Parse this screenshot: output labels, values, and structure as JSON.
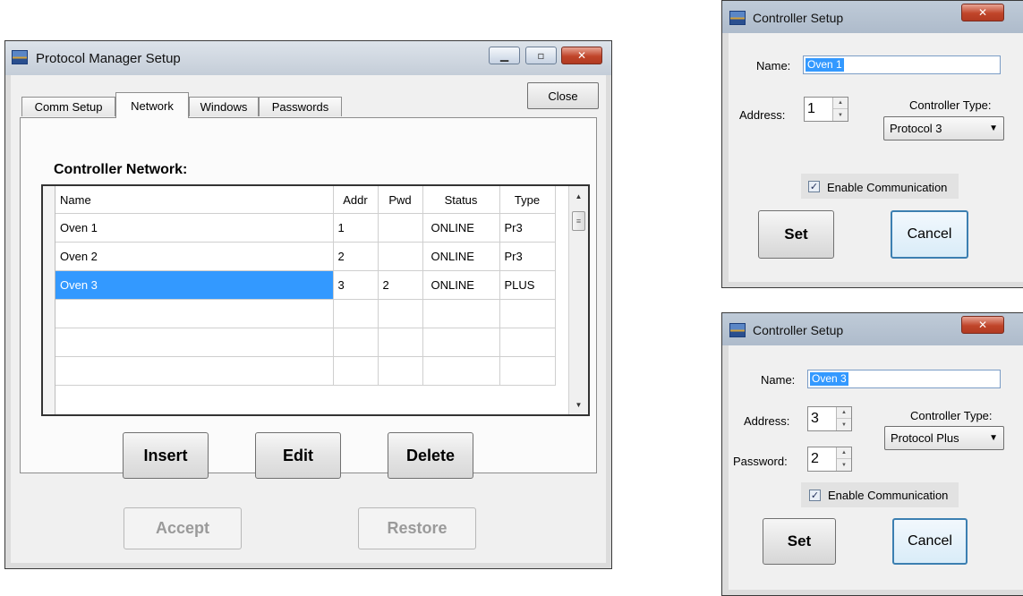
{
  "main_window": {
    "title": "Protocol Manager Setup",
    "close_label": "Close",
    "tabs": [
      {
        "label": "Comm Setup",
        "active": false
      },
      {
        "label": "Network",
        "active": true
      },
      {
        "label": "Windows",
        "active": false
      },
      {
        "label": "Passwords",
        "active": false
      }
    ],
    "section_label": "Controller Network:",
    "table": {
      "headers": [
        "Name",
        "Addr",
        "Pwd",
        "Status",
        "Type"
      ],
      "rows": [
        [
          "Oven 1",
          "1",
          "",
          "ONLINE",
          "Pr3"
        ],
        [
          "Oven 2",
          "2",
          "",
          "ONLINE",
          "Pr3"
        ],
        [
          "Oven 3",
          "3",
          "2",
          "ONLINE",
          "PLUS"
        ],
        [
          "",
          "",
          "",
          "",
          ""
        ],
        [
          "",
          "",
          "",
          "",
          ""
        ],
        [
          "",
          "",
          "",
          "",
          ""
        ]
      ],
      "selected_row": 2
    },
    "buttons": {
      "insert": "Insert",
      "edit": "Edit",
      "delete": "Delete",
      "accept": "Accept",
      "restore": "Restore"
    }
  },
  "dialog1": {
    "title": "Controller Setup",
    "name_label": "Name:",
    "name_value": "Oven 1",
    "address_label": "Address:",
    "address_value": "1",
    "type_label": "Controller Type:",
    "type_value": "Protocol 3",
    "enable_label": "Enable Communication",
    "enable_checked": true,
    "set_label": "Set",
    "cancel_label": "Cancel"
  },
  "dialog2": {
    "title": "Controller Setup",
    "name_label": "Name:",
    "name_value": "Oven 3",
    "address_label": "Address:",
    "address_value": "3",
    "password_label": "Password:",
    "password_value": "2",
    "type_label": "Controller Type:",
    "type_value": "Protocol Plus",
    "enable_label": "Enable Communication",
    "enable_checked": true,
    "set_label": "Set",
    "cancel_label": "Cancel"
  },
  "icons": {
    "app": "app-icon",
    "minimize": "minimize-icon",
    "maximize": "maximize-icon",
    "close": "close-icon",
    "dropdown": "chevron-down-icon",
    "check": "checkmark-icon"
  },
  "colors": {
    "selection": "#3399ff",
    "close_button": "#c0452a",
    "focus_border": "#3c7fb1"
  }
}
